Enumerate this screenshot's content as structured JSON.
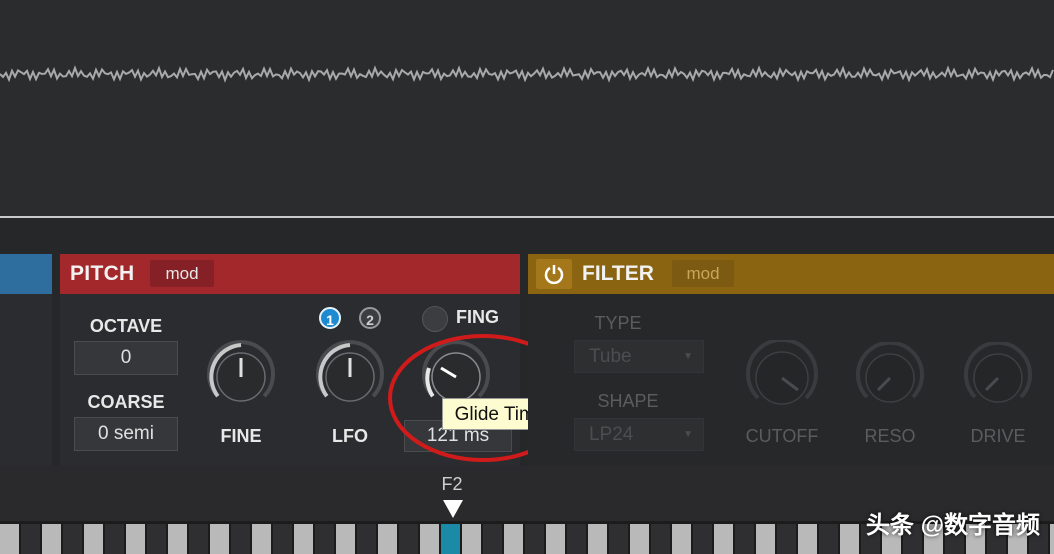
{
  "pitch": {
    "title": "PITCH",
    "mod_label": "mod",
    "octave": {
      "label": "OCTAVE",
      "value": "0"
    },
    "coarse": {
      "label": "COARSE",
      "value": "0 semi"
    },
    "fine_label": "FINE",
    "lfo": {
      "label": "LFO",
      "badge1": "1",
      "badge2": "2"
    },
    "fing_label": "FING",
    "glide_value": "121 ms",
    "tooltip": "Glide Time"
  },
  "filter": {
    "title": "FILTER",
    "mod_label": "mod",
    "type": {
      "label": "TYPE",
      "value": "Tube"
    },
    "shape": {
      "label": "SHAPE",
      "value": "LP24"
    },
    "knobs": {
      "cutoff": "CUTOFF",
      "reso": "RESO",
      "drive": "DRIVE"
    }
  },
  "keyboard": {
    "note_label": "F2"
  },
  "watermark": "头条 @数字音频",
  "colors": {
    "pitch_header": "#a3282b",
    "filter_header": "#8a6410",
    "lfo_accent": "#1e8bd1",
    "active_key": "#1a8aa6"
  },
  "icons": {
    "filter_power": "power-icon",
    "dropdown": "chevron-down-icon",
    "note_marker": "triangle-down-icon"
  }
}
